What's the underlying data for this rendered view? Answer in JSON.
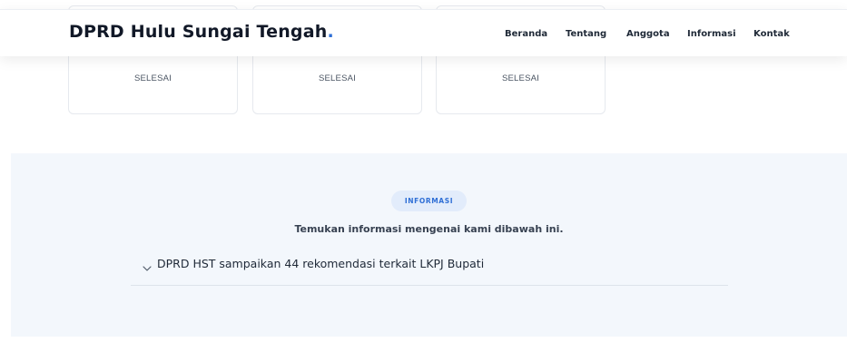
{
  "brand": {
    "title": "DPRD Hulu Sungai Tengah",
    "dot": ".",
    "accent": "#2f6fd6"
  },
  "nav": {
    "items": [
      "Beranda",
      "Tentang",
      "Anggota",
      "Informasi",
      "Kontak"
    ]
  },
  "cards": [
    {
      "status": "SELESAI"
    },
    {
      "status": "SELESAI"
    },
    {
      "status": "SELESAI"
    }
  ],
  "info": {
    "badge": "INFORMASI",
    "subtitle": "Temukan informasi mengenai kami dibawah ini.",
    "faq": [
      {
        "question": "DPRD HST sampaikan 44 rekomendasi terkait LKPJ Bupati",
        "icon": "chevron-down-icon"
      }
    ]
  }
}
